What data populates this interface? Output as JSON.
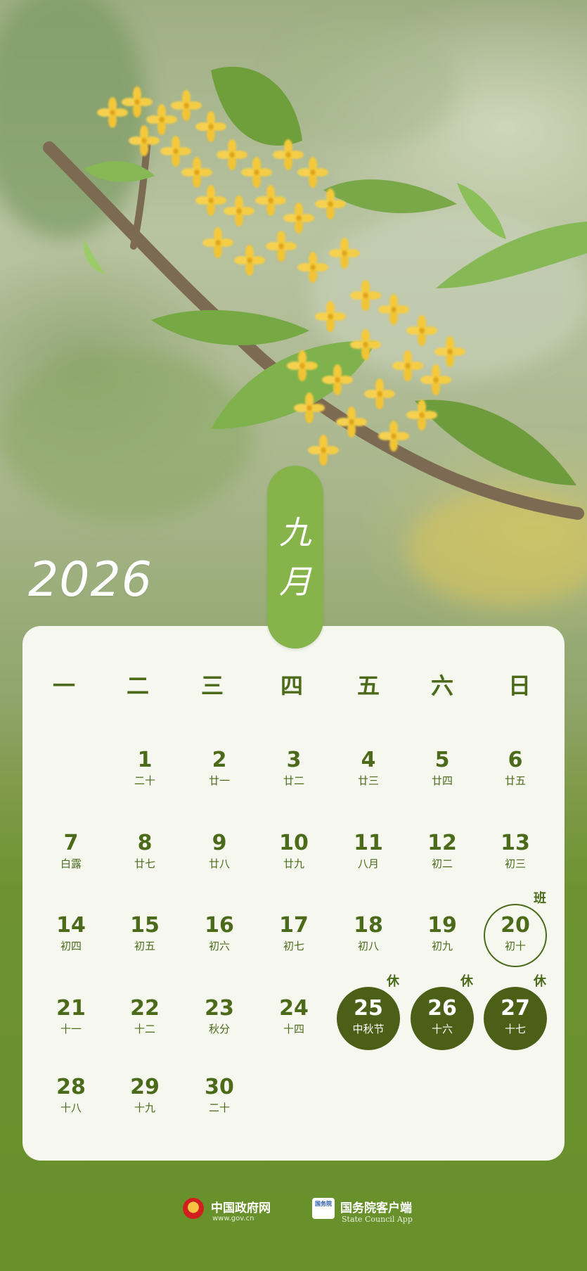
{
  "year": "2026",
  "month_name": [
    "九",
    "月"
  ],
  "weekdays": [
    "一",
    "二",
    "三",
    "四",
    "五",
    "六",
    "日"
  ],
  "days": [
    {
      "num": "1",
      "lunar": "二十"
    },
    {
      "num": "2",
      "lunar": "廿一"
    },
    {
      "num": "3",
      "lunar": "廿二"
    },
    {
      "num": "4",
      "lunar": "廿三"
    },
    {
      "num": "5",
      "lunar": "廿四"
    },
    {
      "num": "6",
      "lunar": "廿五"
    },
    {
      "num": "7",
      "lunar": "白露"
    },
    {
      "num": "8",
      "lunar": "廿七"
    },
    {
      "num": "9",
      "lunar": "廿八"
    },
    {
      "num": "10",
      "lunar": "廿九"
    },
    {
      "num": "11",
      "lunar": "八月"
    },
    {
      "num": "12",
      "lunar": "初二"
    },
    {
      "num": "13",
      "lunar": "初三"
    },
    {
      "num": "14",
      "lunar": "初四"
    },
    {
      "num": "15",
      "lunar": "初五"
    },
    {
      "num": "16",
      "lunar": "初六"
    },
    {
      "num": "17",
      "lunar": "初七"
    },
    {
      "num": "18",
      "lunar": "初八"
    },
    {
      "num": "19",
      "lunar": "初九"
    },
    {
      "num": "20",
      "lunar": "初十",
      "badge": "班"
    },
    {
      "num": "21",
      "lunar": "十一"
    },
    {
      "num": "22",
      "lunar": "十二"
    },
    {
      "num": "23",
      "lunar": "秋分"
    },
    {
      "num": "24",
      "lunar": "十四"
    },
    {
      "num": "25",
      "lunar": "中秋节",
      "badge": "休"
    },
    {
      "num": "26",
      "lunar": "十六",
      "badge": "休"
    },
    {
      "num": "27",
      "lunar": "十七",
      "badge": "休"
    },
    {
      "num": "28",
      "lunar": "十八"
    },
    {
      "num": "29",
      "lunar": "十九"
    },
    {
      "num": "30",
      "lunar": "二十"
    }
  ],
  "footer": {
    "brand1": "中国政府网",
    "brand1_url": "www.gov.cn",
    "logo2_text": "国务院",
    "brand2": "国务院客户端",
    "brand2_sub": "State Council App"
  },
  "colors": {
    "accent_dark": "#4b5f17",
    "text_green": "#4b6a1a",
    "tag_green": "#86b44a",
    "card_bg": "#f6f8f0"
  }
}
